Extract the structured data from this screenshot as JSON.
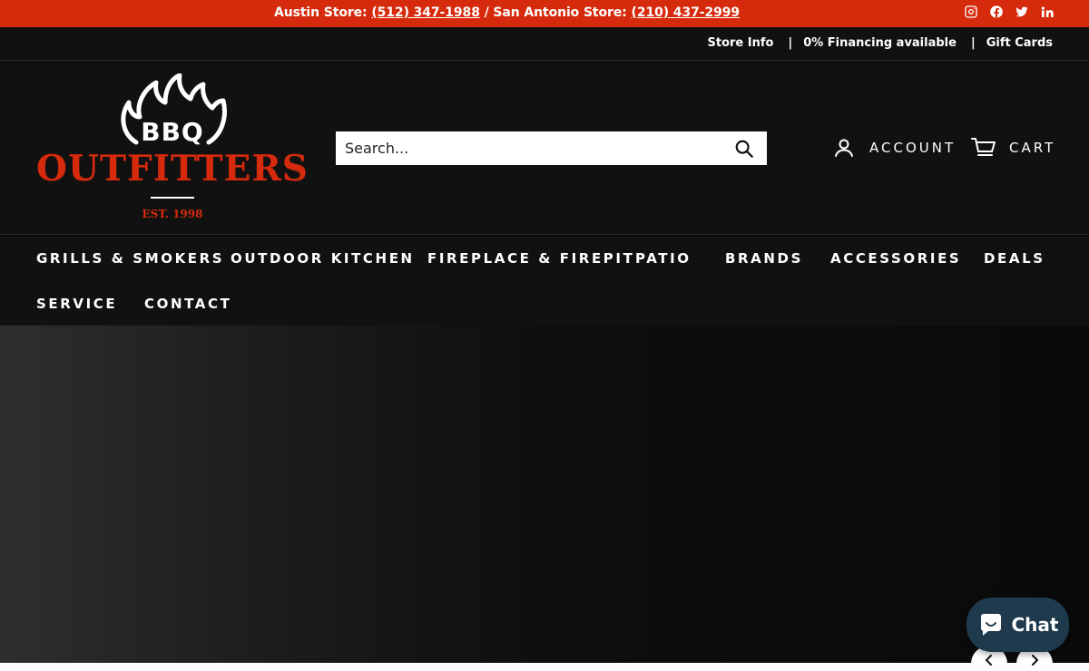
{
  "announcement": {
    "austin_label": "Austin Store: ",
    "austin_phone": "(512) 347-1988",
    "separator": " / San Antonio Store: ",
    "sa_phone": "(210) 437-2999"
  },
  "social_icons": [
    "instagram-icon",
    "facebook-icon",
    "twitter-icon",
    "linkedin-icon"
  ],
  "utility": {
    "store_info": "Store Info",
    "sep": "|",
    "financing": "0% Financing available",
    "gift_cards": "Gift Cards"
  },
  "logo": {
    "bbq": "BBQ",
    "word": "OUTFITTERS",
    "est": "EST. 1998"
  },
  "search": {
    "placeholder": "Search...",
    "button_label": "Search"
  },
  "header": {
    "account": "ACCOUNT",
    "cart": "CART"
  },
  "nav": {
    "items": [
      "GRILLS & SMOKERS",
      "OUTDOOR KITCHEN",
      "FIREPLACE & FIREPIT",
      "PATIO",
      "BRANDS",
      "ACCESSORIES",
      "DEALS",
      "SERVICE",
      "CONTACT"
    ]
  },
  "chat": {
    "label": "Chat"
  },
  "colors": {
    "brand_red": "#d62a0c",
    "dark_bg": "#111111",
    "chat_bg": "#1e3a4c"
  }
}
